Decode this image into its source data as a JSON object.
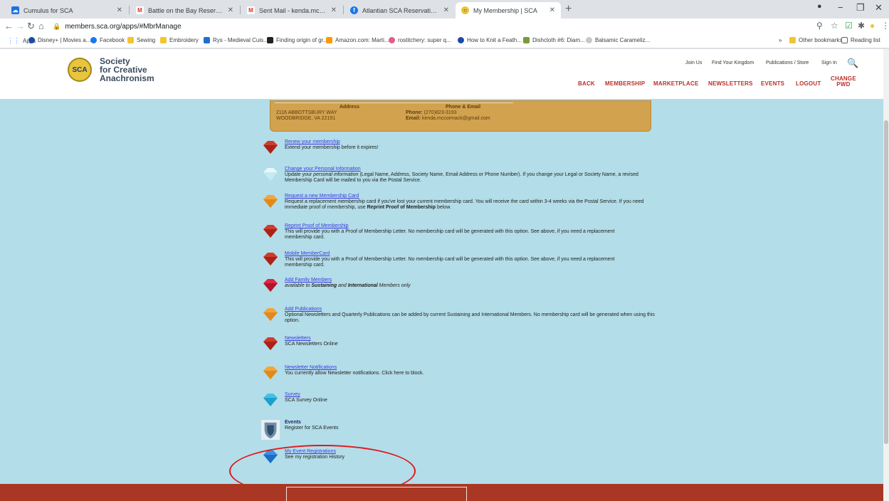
{
  "browser": {
    "tabs": [
      {
        "label": "Cumulus for SCA",
        "color": "#1a73e8",
        "active": false
      },
      {
        "label": "Battle on the Bay Reservation - s",
        "color": "#d93025",
        "active": false
      },
      {
        "label": "Sent Mail - kenda.mccormack@g",
        "color": "#d93025",
        "active": false
      },
      {
        "label": "Atlantian SCA Reservation Syste",
        "color": "#1877f2",
        "active": false
      },
      {
        "label": "My Membership | SCA",
        "color": "#e8c53a",
        "active": true
      }
    ],
    "url": "members.sca.org/apps/#MbrManage",
    "bookmarks": [
      {
        "label": "Apps",
        "color": "#4285f4"
      },
      {
        "label": "Disney+ | Movies a...",
        "color": "#1a4aa8"
      },
      {
        "label": "Facebook",
        "color": "#1877f2"
      },
      {
        "label": "Sewing",
        "color": "#f4c430"
      },
      {
        "label": "Embroidery",
        "color": "#f4c430"
      },
      {
        "label": "Rys - Medieval Cuis...",
        "color": "#1f6fd1"
      },
      {
        "label": "Finding origin of gr...",
        "color": "#222222"
      },
      {
        "label": "Amazon.com: Marti...",
        "color": "#ff9900"
      },
      {
        "label": "rostitchery: super q...",
        "color": "#e85a8a"
      },
      {
        "label": "How to Knit a Feath...",
        "color": "#1a4aa8"
      },
      {
        "label": "Dishcloth #6: Diam...",
        "color": "#7a9a3a"
      },
      {
        "label": "Balsamic Carameliz...",
        "color": "#888888"
      }
    ],
    "bookmarks_more": "»",
    "other_bookmarks": "Other bookmarks",
    "reading_list": "Reading list"
  },
  "site": {
    "logo_text": "SCA",
    "title_line1": "Society",
    "title_line2": "for Creative",
    "title_line3": "Anachronism",
    "top_links": [
      "Join Us",
      "Find Your Kingdom",
      "Publications / Store",
      "Sign In"
    ],
    "nav": [
      "BACK",
      "MEMBERSHIP",
      "MARKETPLACE",
      "NEWSLETTERS",
      "EVENTS",
      "LOGOUT"
    ],
    "nav_change_line1": "CHANGE",
    "nav_change_line2": "PWD",
    "accent": "#b9302a"
  },
  "address_card": {
    "address_header": "Address",
    "address_line1": "2116 ABBOTTSBURY WAY",
    "address_line2": "WOODBRIDGE, VA 22191",
    "contact_header": "Phone & Email",
    "phone_label": "Phone:",
    "phone_value": "(270)823-3193",
    "email_label": "Email:",
    "email_value": "kenda.mccormack@gmail.com"
  },
  "items": [
    {
      "title": "Renew your membership",
      "desc": "Extend your membership before it expires!",
      "gem": "red"
    },
    {
      "title": "Change your Personal Information",
      "desc_pre": "Update your ",
      "desc_em": "personal information",
      "desc_post": " (Legal Name, Address, Society Name, Email Address or Phone Number). If you change your Legal or Society Name, a revised Membership Card will be mailed to you via the Postal Service.",
      "gem": "white"
    },
    {
      "title": "Request a new Membership Card",
      "desc_pre": "Request a replacement membership card if you've lost your current membership card. You will receive the card within 3-4 weeks via the Postal Service. If you need immediate proof of membership, use ",
      "desc_strong": "Reprint Proof of Membership",
      "desc_post": " below.",
      "gem": "orange"
    },
    {
      "title": "Reprint Proof of Membership",
      "desc": "This will provide you with a Proof of Membership Letter. No membership card will be generated with this option. See above, if you need a replacement membership card.",
      "gem": "red"
    },
    {
      "title": "Mobile MemberCard",
      "desc": "This will provide you with a Proof of Membership Letter. No membership card will be generated with this option. See above, if you need a replacement membership card.",
      "gem": "red"
    },
    {
      "title": "Add Family Members",
      "desc_pre": "available to ",
      "desc_strong": "Sustaining",
      "desc_mid": " and ",
      "desc_strong2": "International",
      "desc_post": " Members only",
      "gem": "red2"
    },
    {
      "title": "Add Publications",
      "desc": "Optional Newsletters and Quarterly Publications can be added by current Sustaining and International Members. No membership card will be generated when using this option.",
      "gem": "orange"
    },
    {
      "title": "Newsletters",
      "desc": "SCA Newsletters Online",
      "gem": "red"
    },
    {
      "title": "Newsletter Notifications",
      "desc": "You currently allow Newsletter notifications. Click here to block.",
      "gem": "orange"
    },
    {
      "title": "Survey",
      "desc": "SCA Survey Online",
      "gem": "cyan"
    },
    {
      "title": "Events",
      "desc": "Register for SCA Events",
      "gem": "shield"
    },
    {
      "title": "My Event Registrations",
      "desc": "See my registration History",
      "gem": "blue"
    }
  ]
}
